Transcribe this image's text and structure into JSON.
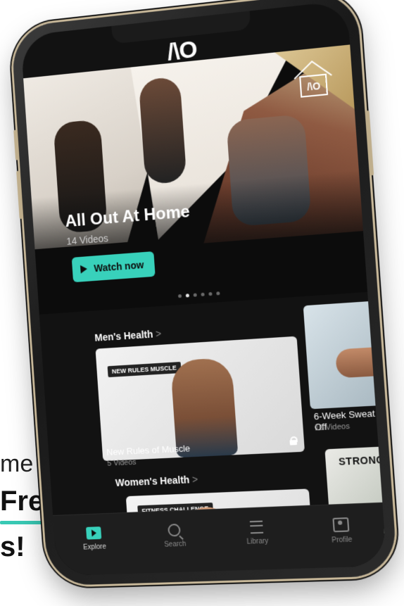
{
  "promo": {
    "line1": "me",
    "line2": "Free",
    "line3": "s!"
  },
  "app": {
    "logo": "/\\O"
  },
  "hero": {
    "title": "All Out At Home",
    "subtitle": "14 Videos",
    "watch_label": "Watch now",
    "pager_total": 6,
    "pager_active_index": 1
  },
  "sections": {
    "mens": {
      "title": "Men's Health",
      "chevron": ">",
      "cards": [
        {
          "badge": "NEW RULES MUSCLE",
          "title": "New Rules of Muscle",
          "meta": "5 Videos"
        },
        {
          "title": "6-Week Sweat Off",
          "meta": "10 Videos"
        }
      ]
    },
    "womens": {
      "title": "Women's Health",
      "chevron": ">",
      "cards": [
        {
          "badge": "FITNESS CHALLENGE"
        },
        {
          "sign": "STRONG"
        }
      ]
    }
  },
  "tabbar": {
    "tabs": [
      {
        "label": "Explore",
        "icon": "explore-icon",
        "active": true
      },
      {
        "label": "Search",
        "icon": "search-icon",
        "active": false
      },
      {
        "label": "Library",
        "icon": "library-icon",
        "active": false
      },
      {
        "label": "Profile",
        "icon": "profile-icon",
        "active": false
      }
    ]
  },
  "colors": {
    "accent": "#38d1bb",
    "background": "#121212",
    "phone_trim": "#c9b99a"
  }
}
